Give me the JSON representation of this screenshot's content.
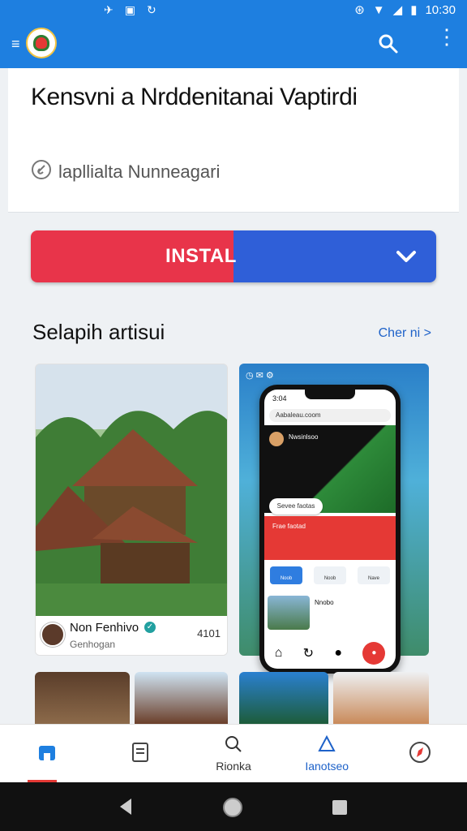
{
  "status_bar": {
    "time": "10:30",
    "left_icons": [
      "notification-icon",
      "image-icon",
      "sync-icon"
    ],
    "right_icons": [
      "vpn-icon",
      "wifi-icon",
      "signal-icon",
      "battery-icon"
    ]
  },
  "app_bar": {
    "logo": "app-logo",
    "actions": [
      "search-icon",
      "more-vert-icon"
    ],
    "accent": "#1e7fe0"
  },
  "app": {
    "title": "Kensvni a Nrddenitanai Vaptirdi",
    "developer": "lapllialta Nunneagari"
  },
  "install": {
    "label": "INSTAL",
    "colors": [
      "#e8344a",
      "#2f5fd8"
    ]
  },
  "screenshots_section": {
    "title": "Selapih artisui",
    "see_more": "Cher ni >",
    "card1": {
      "name": "Non Fenhivo",
      "sub": "Genhogan",
      "count": "4101"
    },
    "phone": {
      "status": "3:04",
      "url": "Aabaleau.coom",
      "video_title": "Nwsinlsoo",
      "pill": "Sevee faotas",
      "banner": "Frae faotad",
      "actions": [
        "Noob",
        "Noob",
        "Nave"
      ],
      "item": "Nnobo"
    }
  },
  "bottom_nav": {
    "items": [
      {
        "icon": "home-icon",
        "label": ""
      },
      {
        "icon": "document-icon",
        "label": ""
      },
      {
        "icon": "search-icon",
        "label": "Rionka"
      },
      {
        "icon": "apps-icon",
        "label": "Ianotseo"
      },
      {
        "icon": "compass-icon",
        "label": ""
      }
    ]
  }
}
